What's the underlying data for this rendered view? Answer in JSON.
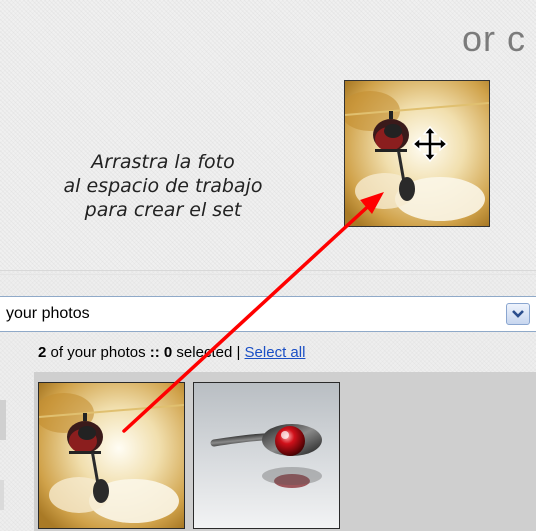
{
  "header": {
    "or_text": "or c"
  },
  "instructions": {
    "line1": "Arrastra la foto",
    "line2": "al espacio de trabajo",
    "line3": "para crear el set"
  },
  "source_select": {
    "value": "your photos"
  },
  "status": {
    "count": "2",
    "of_text": " of your photos ",
    "separator": "::",
    "selected_count": " 0",
    "selected_text": " selected | ",
    "select_all_label": "Select all"
  },
  "photos": [
    {
      "subject": "helicopter over smoke"
    },
    {
      "subject": "spoon with red sphere"
    }
  ],
  "colors": {
    "link": "#1a4fc5",
    "arrow": "#ff0000",
    "dropdown_border": "#8fa9c8"
  },
  "icons": {
    "move": "move-cursor-icon",
    "dropdown": "chevron-down-icon"
  }
}
